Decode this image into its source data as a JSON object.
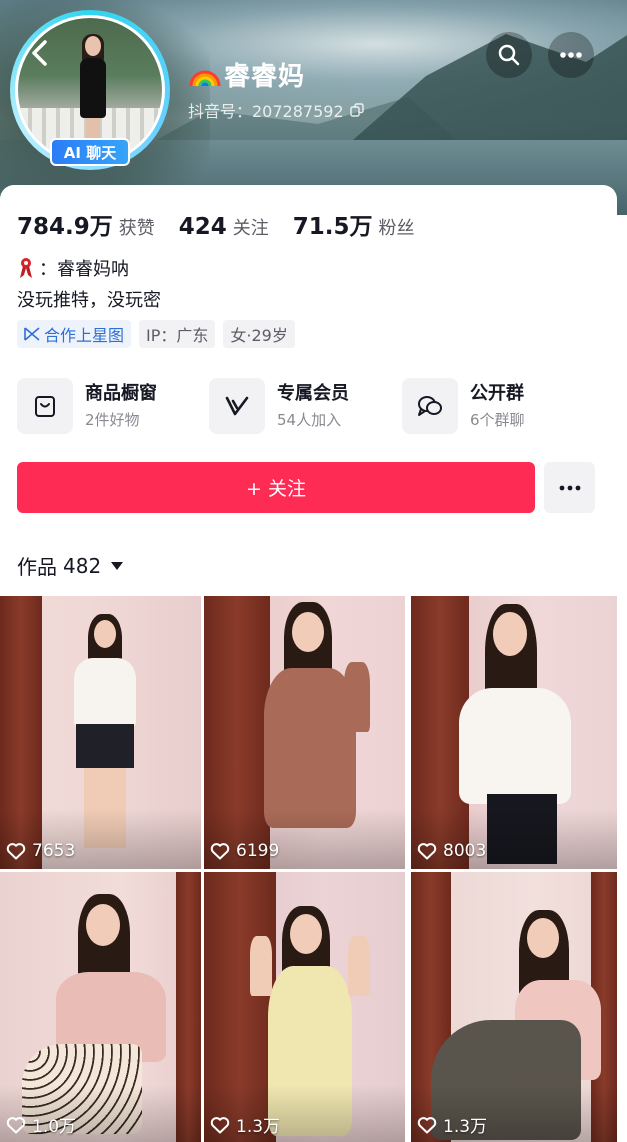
{
  "header": {
    "username": "睿睿妈",
    "douyin_id": "抖音号：207287592",
    "ai_badge": "AI 聊天"
  },
  "stats": [
    {
      "value": "784.9万",
      "label": "获赞"
    },
    {
      "value": "424",
      "label": "关注"
    },
    {
      "value": "71.5万",
      "label": "粉丝"
    }
  ],
  "bio": {
    "line1": "：睿睿妈呐",
    "line2": "没玩推特，没玩密"
  },
  "tags": [
    "合作上星图",
    "IP：广东",
    "女·29岁"
  ],
  "services": [
    {
      "title": "商品橱窗",
      "subtitle": "2件好物",
      "icon": "shopping-bag-icon"
    },
    {
      "title": "专属会员",
      "subtitle": "54人加入",
      "icon": "membership-v-icon"
    },
    {
      "title": "公开群",
      "subtitle": "6个群聊",
      "icon": "group-chat-icon"
    }
  ],
  "follow_button": "+ 关注",
  "works_tab": {
    "label": "作品",
    "count": "482"
  },
  "videos": [
    {
      "likes": "7653"
    },
    {
      "likes": "6199"
    },
    {
      "likes": "8003"
    },
    {
      "likes": "1.0万"
    },
    {
      "likes": "1.3万"
    },
    {
      "likes": "1.3万"
    }
  ],
  "colors": {
    "accent": "#fe2c55",
    "ai_badge": "#2c7cf5",
    "tag_blue": "#2d6fd6"
  }
}
